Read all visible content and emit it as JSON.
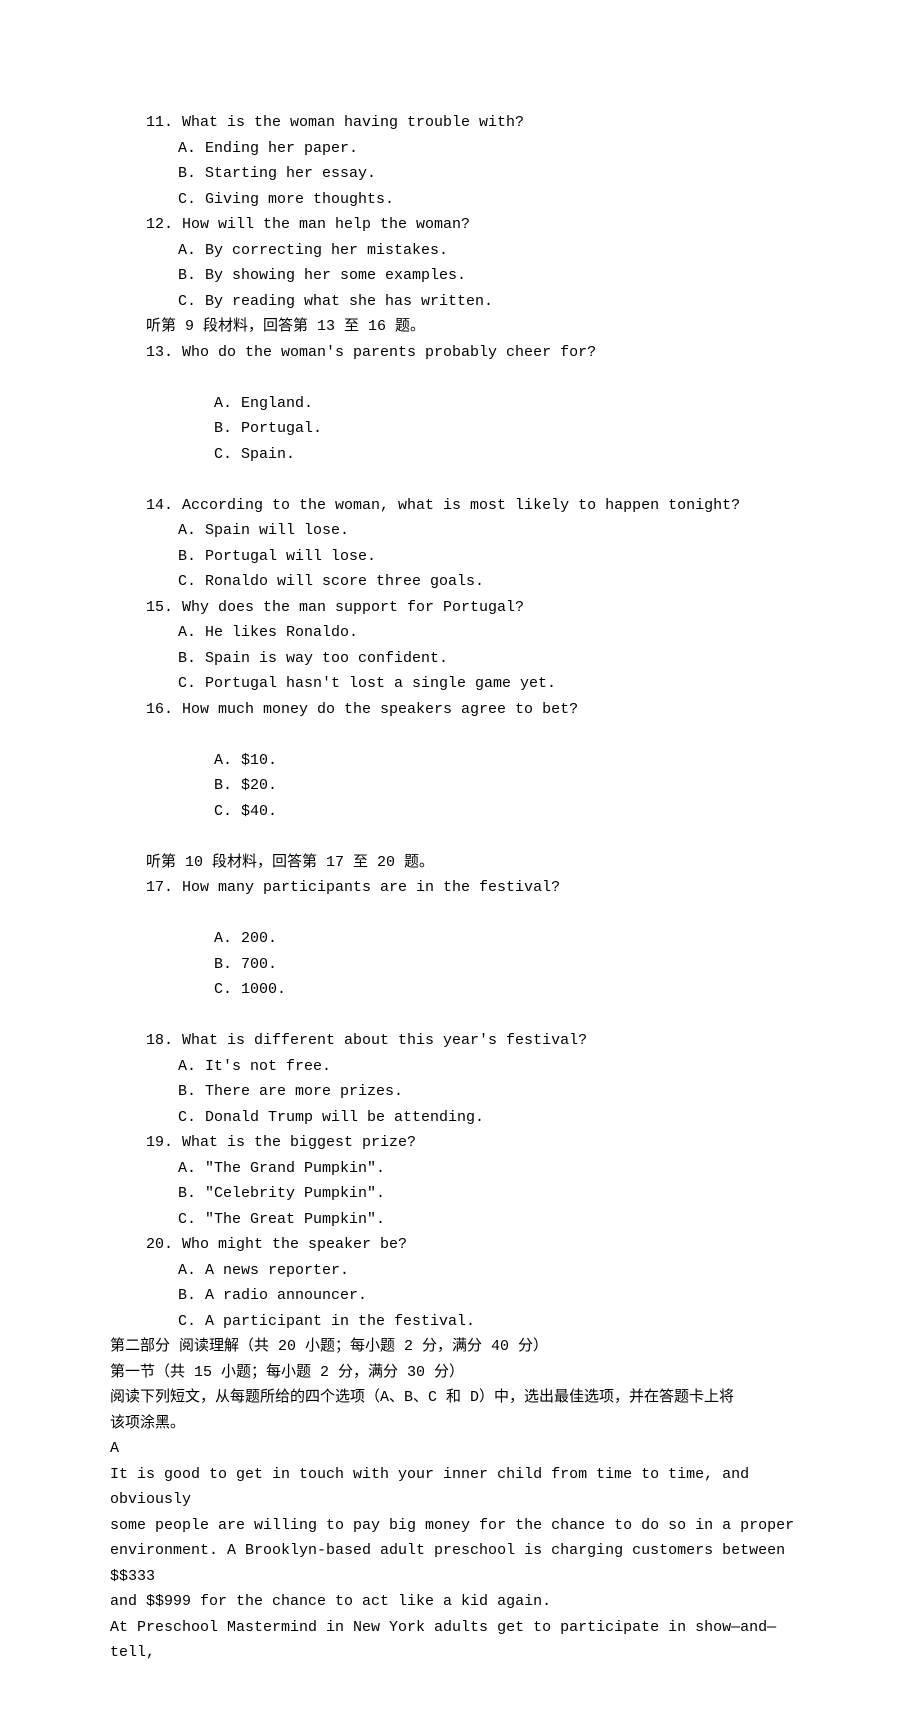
{
  "q11": {
    "stem": "11. What is the woman having trouble with?",
    "a": "A. Ending her paper.",
    "b": "B. Starting her essay.",
    "c": "C. Giving more thoughts."
  },
  "q12": {
    "stem": "12. How will the man help the woman?",
    "a": "A. By correcting her mistakes.",
    "b": "B. By showing her some examples.",
    "c": "C. By reading what she has written."
  },
  "sec9": "听第 9 段材料，回答第 13 至 16 题。",
  "q13": {
    "stem": "13. Who do the woman's parents probably cheer for?",
    "a": "A. England.",
    "b": "B. Portugal.",
    "c": "C. Spain."
  },
  "q14": {
    "stem": "14. According to the woman, what is most likely to happen tonight?",
    "a": "A. Spain will lose.",
    "b": "B. Portugal will lose.",
    "c": "C. Ronaldo will score three goals."
  },
  "q15": {
    "stem": "15. Why does the man support for Portugal?",
    "a": "A. He likes Ronaldo.",
    "b": "B. Spain is way too confident.",
    "c": "C. Portugal hasn't lost a single game yet."
  },
  "q16": {
    "stem": "16. How much money do the speakers agree to bet?",
    "a": "A. $10.",
    "b": "B. $20.",
    "c": "C. $40."
  },
  "sec10": "听第 10 段材料，回答第 17 至 20 题。",
  "q17": {
    "stem": "17. How many participants are in the festival?",
    "a": "A. 200.",
    "b": "B. 700.",
    "c": "C. 1000."
  },
  "q18": {
    "stem": "18. What is different about this year's festival?",
    "a": "A. It's not free.",
    "b": "B. There are more prizes.",
    "c": "C. Donald Trump will be attending."
  },
  "q19": {
    "stem": "19. What is the biggest prize?",
    "a": "A. \"The Grand Pumpkin\".",
    "b": "B. \"Celebrity Pumpkin\".",
    "c": "C. \"The Great Pumpkin\"."
  },
  "q20": {
    "stem": "20. Who might the speaker be?",
    "a": "A. A news reporter.",
    "b": "B. A radio announcer.",
    "c": "C. A participant in the festival."
  },
  "part2_header": "第二部分 阅读理解（共 20 小题；每小题 2 分，满分 40 分）",
  "part2_sub": "第一节（共 15 小题；每小题 2 分，满分 30 分）",
  "part2_instr1": "阅读下列短文，从每题所给的四个选项（A、B、C 和 D）中，选出最佳选项，并在答题卡上将",
  "part2_instr2": "该项涂黑。",
  "passage_label": "A",
  "passage": {
    "p1": "It is good to get in touch with your inner child from time to time, and obviously",
    "p2": "some people are willing to pay big money for the chance to do so in a proper",
    "p3": "environment. A Brooklyn-based adult preschool is charging customers between $$333",
    "p4": "and $$999 for the chance to act like a kid again.",
    "p5": "At Preschool Mastermind in New York adults get to participate in show—and—tell,"
  }
}
